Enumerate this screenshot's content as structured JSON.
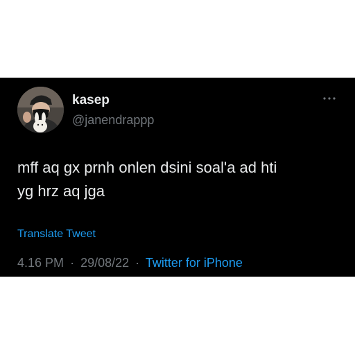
{
  "tweet": {
    "display_name": "kasep",
    "handle": "@janendrappp",
    "text_line1": "mff aq gx prnh onlen dsini soal'a ad hti",
    "text_line2": "yg hrz aq jga",
    "translate_label": "Translate Tweet",
    "time": "4.16 PM",
    "date": "29/08/22",
    "separator": "·",
    "source": "Twitter for iPhone",
    "more_icon": "more-horizontal-icon"
  },
  "colors": {
    "card_background": "#000000",
    "page_background": "#ffffff",
    "primary_text": "#e7e9ea",
    "secondary_text": "#71767b",
    "link": "#1d9bf0"
  }
}
